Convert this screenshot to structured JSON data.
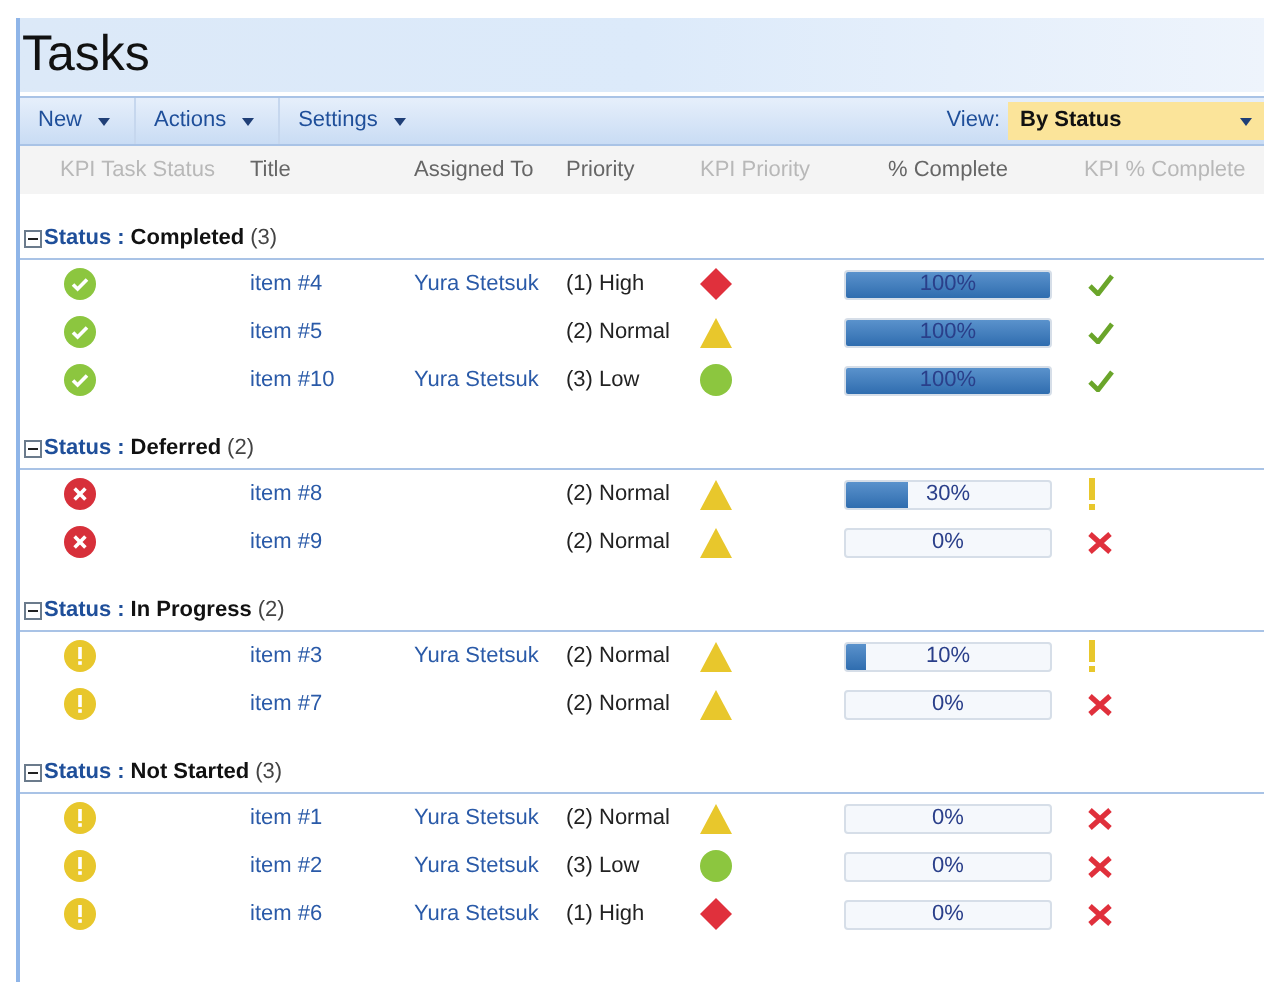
{
  "title": "Tasks",
  "toolbar": {
    "menus": [
      {
        "label": "New"
      },
      {
        "label": "Actions"
      },
      {
        "label": "Settings"
      }
    ],
    "view_label": "View:",
    "view_value": "By Status"
  },
  "columns": [
    {
      "label": "KPI Task Status",
      "dim": true
    },
    {
      "label": "Title",
      "dim": false
    },
    {
      "label": "Assigned To",
      "dim": false
    },
    {
      "label": "Priority",
      "dim": false
    },
    {
      "label": "KPI Priority",
      "dim": true
    },
    {
      "label": "% Complete",
      "dim": false
    },
    {
      "label": "KPI % Complete",
      "dim": true
    }
  ],
  "groups": [
    {
      "field": "Status",
      "separator": ":",
      "value": "Completed",
      "count": "(3)",
      "expanded": true,
      "rows": [
        {
          "status_icon": {
            "kind": "done"
          },
          "title": "item #4",
          "assigned": "Yura Stetsuk",
          "priority": "(1) High",
          "priority_icon": {
            "kind": "high"
          },
          "level": 1,
          "reading": "100%",
          "kpi_icon": {
            "kind": "check"
          }
        },
        {
          "status_icon": {
            "kind": "done"
          },
          "title": "item #5",
          "priority": "(2) Normal",
          "priority_icon": {
            "kind": "normal"
          },
          "level": 1,
          "reading": "100%",
          "kpi_icon": {
            "kind": "check"
          }
        },
        {
          "status_icon": {
            "kind": "done"
          },
          "title": "item #10",
          "assigned": "Yura Stetsuk",
          "priority": "(3) Low",
          "priority_icon": {
            "kind": "low"
          },
          "level": 1,
          "reading": "100%",
          "kpi_icon": {
            "kind": "check"
          }
        }
      ]
    },
    {
      "field": "Status",
      "separator": ":",
      "value": "Deferred",
      "count": "(2)",
      "expanded": true,
      "rows": [
        {
          "status_icon": {
            "kind": "failed"
          },
          "title": "item #8",
          "priority": "(2) Normal",
          "priority_icon": {
            "kind": "normal"
          },
          "level": 0.3,
          "reading": "30%",
          "kpi_icon": {
            "kind": "warning"
          }
        },
        {
          "status_icon": {
            "kind": "failed"
          },
          "title": "item #9",
          "priority": "(2) Normal",
          "priority_icon": {
            "kind": "normal"
          },
          "level": 0,
          "reading": "0%",
          "kpi_icon": {
            "kind": "cross"
          }
        }
      ]
    },
    {
      "field": "Status",
      "separator": ":",
      "value": "In Progress",
      "count": "(2)",
      "expanded": true,
      "rows": [
        {
          "status_icon": {
            "kind": "warning"
          },
          "title": "item #3",
          "assigned": "Yura Stetsuk",
          "priority": "(2) Normal",
          "priority_icon": {
            "kind": "normal"
          },
          "level": 0.1,
          "reading": "10%",
          "kpi_icon": {
            "kind": "warning"
          }
        },
        {
          "status_icon": {
            "kind": "warning"
          },
          "title": "item #7",
          "priority": "(2) Normal",
          "priority_icon": {
            "kind": "normal"
          },
          "level": 0,
          "reading": "0%",
          "kpi_icon": {
            "kind": "cross"
          }
        }
      ]
    },
    {
      "field": "Status",
      "separator": ":",
      "value": "Not Started",
      "count": "(3)",
      "expanded": true,
      "rows": [
        {
          "status_icon": {
            "kind": "warning"
          },
          "title": "item #1",
          "assigned": "Yura Stetsuk",
          "priority": "(2) Normal",
          "priority_icon": {
            "kind": "normal"
          },
          "level": 0,
          "reading": "0%",
          "kpi_icon": {
            "kind": "cross"
          }
        },
        {
          "status_icon": {
            "kind": "warning"
          },
          "title": "item #2",
          "assigned": "Yura Stetsuk",
          "priority": "(3) Low",
          "priority_icon": {
            "kind": "low"
          },
          "level": 0,
          "reading": "0%",
          "kpi_icon": {
            "kind": "cross"
          }
        },
        {
          "status_icon": {
            "kind": "warning"
          },
          "title": "item #6",
          "assigned": "Yura Stetsuk",
          "priority": "(1) High",
          "priority_icon": {
            "kind": "high"
          },
          "level": 0,
          "reading": "0%",
          "kpi_icon": {
            "kind": "cross"
          }
        }
      ]
    }
  ]
}
